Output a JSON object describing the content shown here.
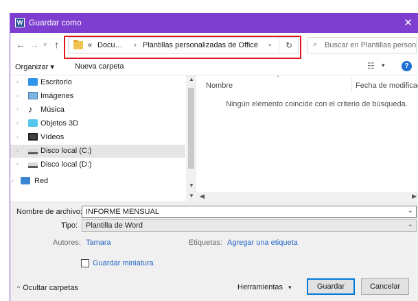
{
  "window": {
    "title": "Guardar como",
    "app_icon_letter": "W",
    "close_glyph": "✕",
    "accent_color": "#7e3fd0"
  },
  "navigation": {
    "back_glyph": "←",
    "forward_glyph": "→",
    "recent_glyph": "˅",
    "up_glyph": "↑"
  },
  "address_bar": {
    "overflow": "«",
    "crumbs": [
      "Docu…",
      "Plantillas personalizadas de Office"
    ],
    "separator": "›",
    "dropdown_glyph": "⌄",
    "refresh_glyph": "↻",
    "highlight_color": "#e0141f"
  },
  "search": {
    "placeholder": "Buscar en Plantillas personal...",
    "icon": "search-icon"
  },
  "command_bar": {
    "organize_label": "Organizar ▾",
    "new_folder_label": "Nueva carpeta",
    "view_glyph": "☷",
    "view_caret": "▾",
    "help_glyph": "?"
  },
  "nav_tree": {
    "items": [
      {
        "label": "Escritorio",
        "icon": "desktop-icon",
        "selected": false
      },
      {
        "label": "Imágenes",
        "icon": "images-icon",
        "selected": false
      },
      {
        "label": "Música",
        "icon": "music-icon",
        "selected": false
      },
      {
        "label": "Objetos 3D",
        "icon": "3d-objects-icon",
        "selected": false
      },
      {
        "label": "Vídeos",
        "icon": "videos-icon",
        "selected": false
      },
      {
        "label": "Disco local (C:)",
        "icon": "local-disk-icon",
        "selected": true
      },
      {
        "label": "Disco local (D:)",
        "icon": "local-disk-icon",
        "selected": false
      },
      {
        "label": "Red",
        "icon": "network-icon",
        "selected": false
      }
    ]
  },
  "file_list": {
    "column_name": "Nombre",
    "column_date": "Fecha de modificación",
    "sort_glyph": "^",
    "empty_message": "Ningún elemento coincide con el criterio de búsqueda."
  },
  "form": {
    "filename_label": "Nombre de archivo:",
    "filename_value": "INFORME MENSUAL",
    "type_label": "Tipo:",
    "type_value": "Plantilla de Word",
    "authors_label": "Autores:",
    "authors_value": "Tamara",
    "tags_label": "Etiquetas:",
    "tags_value": "Agregar una etiqueta",
    "thumbnail_label": "Guardar miniatura",
    "thumbnail_checked": false,
    "field_caret": "⌄"
  },
  "footer": {
    "hide_folders_glyph": "^",
    "hide_folders_label": "Ocultar carpetas",
    "tools_label": "Herramientas",
    "tools_caret": "▾",
    "save_label": "Guardar",
    "cancel_label": "Cancelar"
  }
}
